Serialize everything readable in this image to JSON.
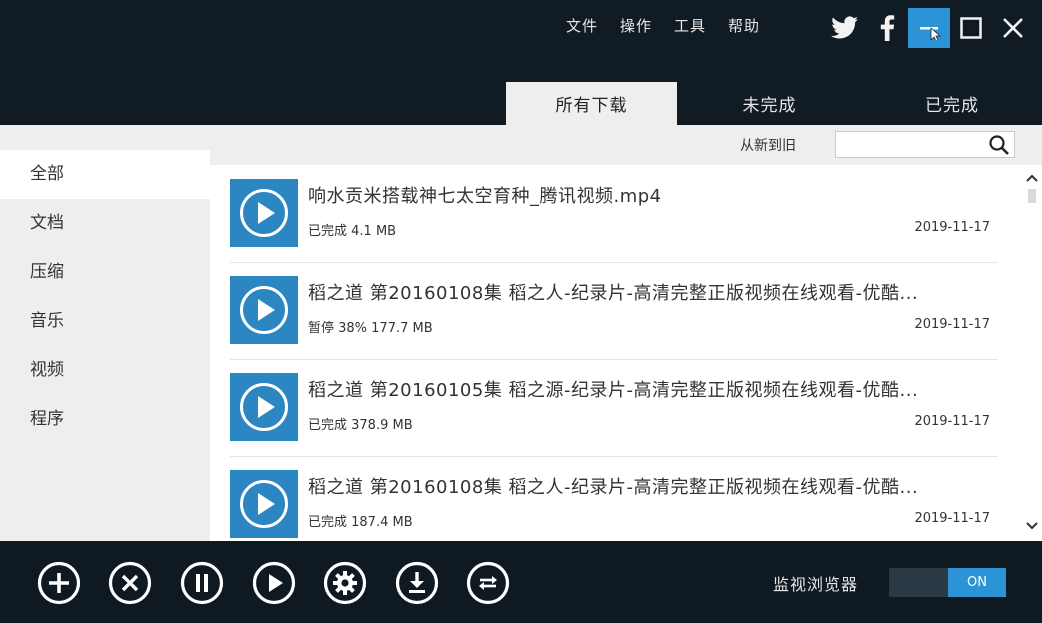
{
  "menu": [
    "文件",
    "操作",
    "工具",
    "帮助"
  ],
  "window_buttons": [
    "twitter-icon",
    "facebook-icon",
    "minimize-icon",
    "maximize-icon",
    "close-icon"
  ],
  "tabs": [
    {
      "label": "所有下载",
      "active": true
    },
    {
      "label": "未完成",
      "active": false
    },
    {
      "label": "已完成",
      "active": false
    }
  ],
  "sidebar": {
    "items": [
      {
        "label": "全部",
        "active": true
      },
      {
        "label": "文档",
        "active": false
      },
      {
        "label": "压缩",
        "active": false
      },
      {
        "label": "音乐",
        "active": false
      },
      {
        "label": "视频",
        "active": false
      },
      {
        "label": "程序",
        "active": false
      }
    ]
  },
  "filter": {
    "sort_label": "从新到旧",
    "search_placeholder": ""
  },
  "downloads": [
    {
      "title": "响水贡米搭载神七太空育种_腾讯视频.mp4",
      "status": "已完成 4.1 MB",
      "date": "2019-11-17"
    },
    {
      "title": "稻之道 第20160108集 稻之人-纪录片-高清完整正版视频在线观看-优酷...",
      "status": "暂停 38% 177.7 MB",
      "date": "2019-11-17"
    },
    {
      "title": "稻之道 第20160105集 稻之源-纪录片-高清完整正版视频在线观看-优酷...",
      "status": "已完成 378.9 MB",
      "date": "2019-11-17"
    },
    {
      "title": "稻之道 第20160108集 稻之人-纪录片-高清完整正版视频在线观看-优酷...",
      "status": "已完成 187.4 MB",
      "date": "2019-11-17"
    }
  ],
  "bottom_buttons": [
    "add-icon",
    "delete-icon",
    "pause-icon",
    "play-icon",
    "settings-icon",
    "download-icon",
    "convert-icon"
  ],
  "monitor": {
    "label": "监视浏览器",
    "toggle": "ON"
  },
  "colors": {
    "accent": "#2c93d6",
    "thumb": "#2b86c1",
    "dark": "#101b24"
  }
}
